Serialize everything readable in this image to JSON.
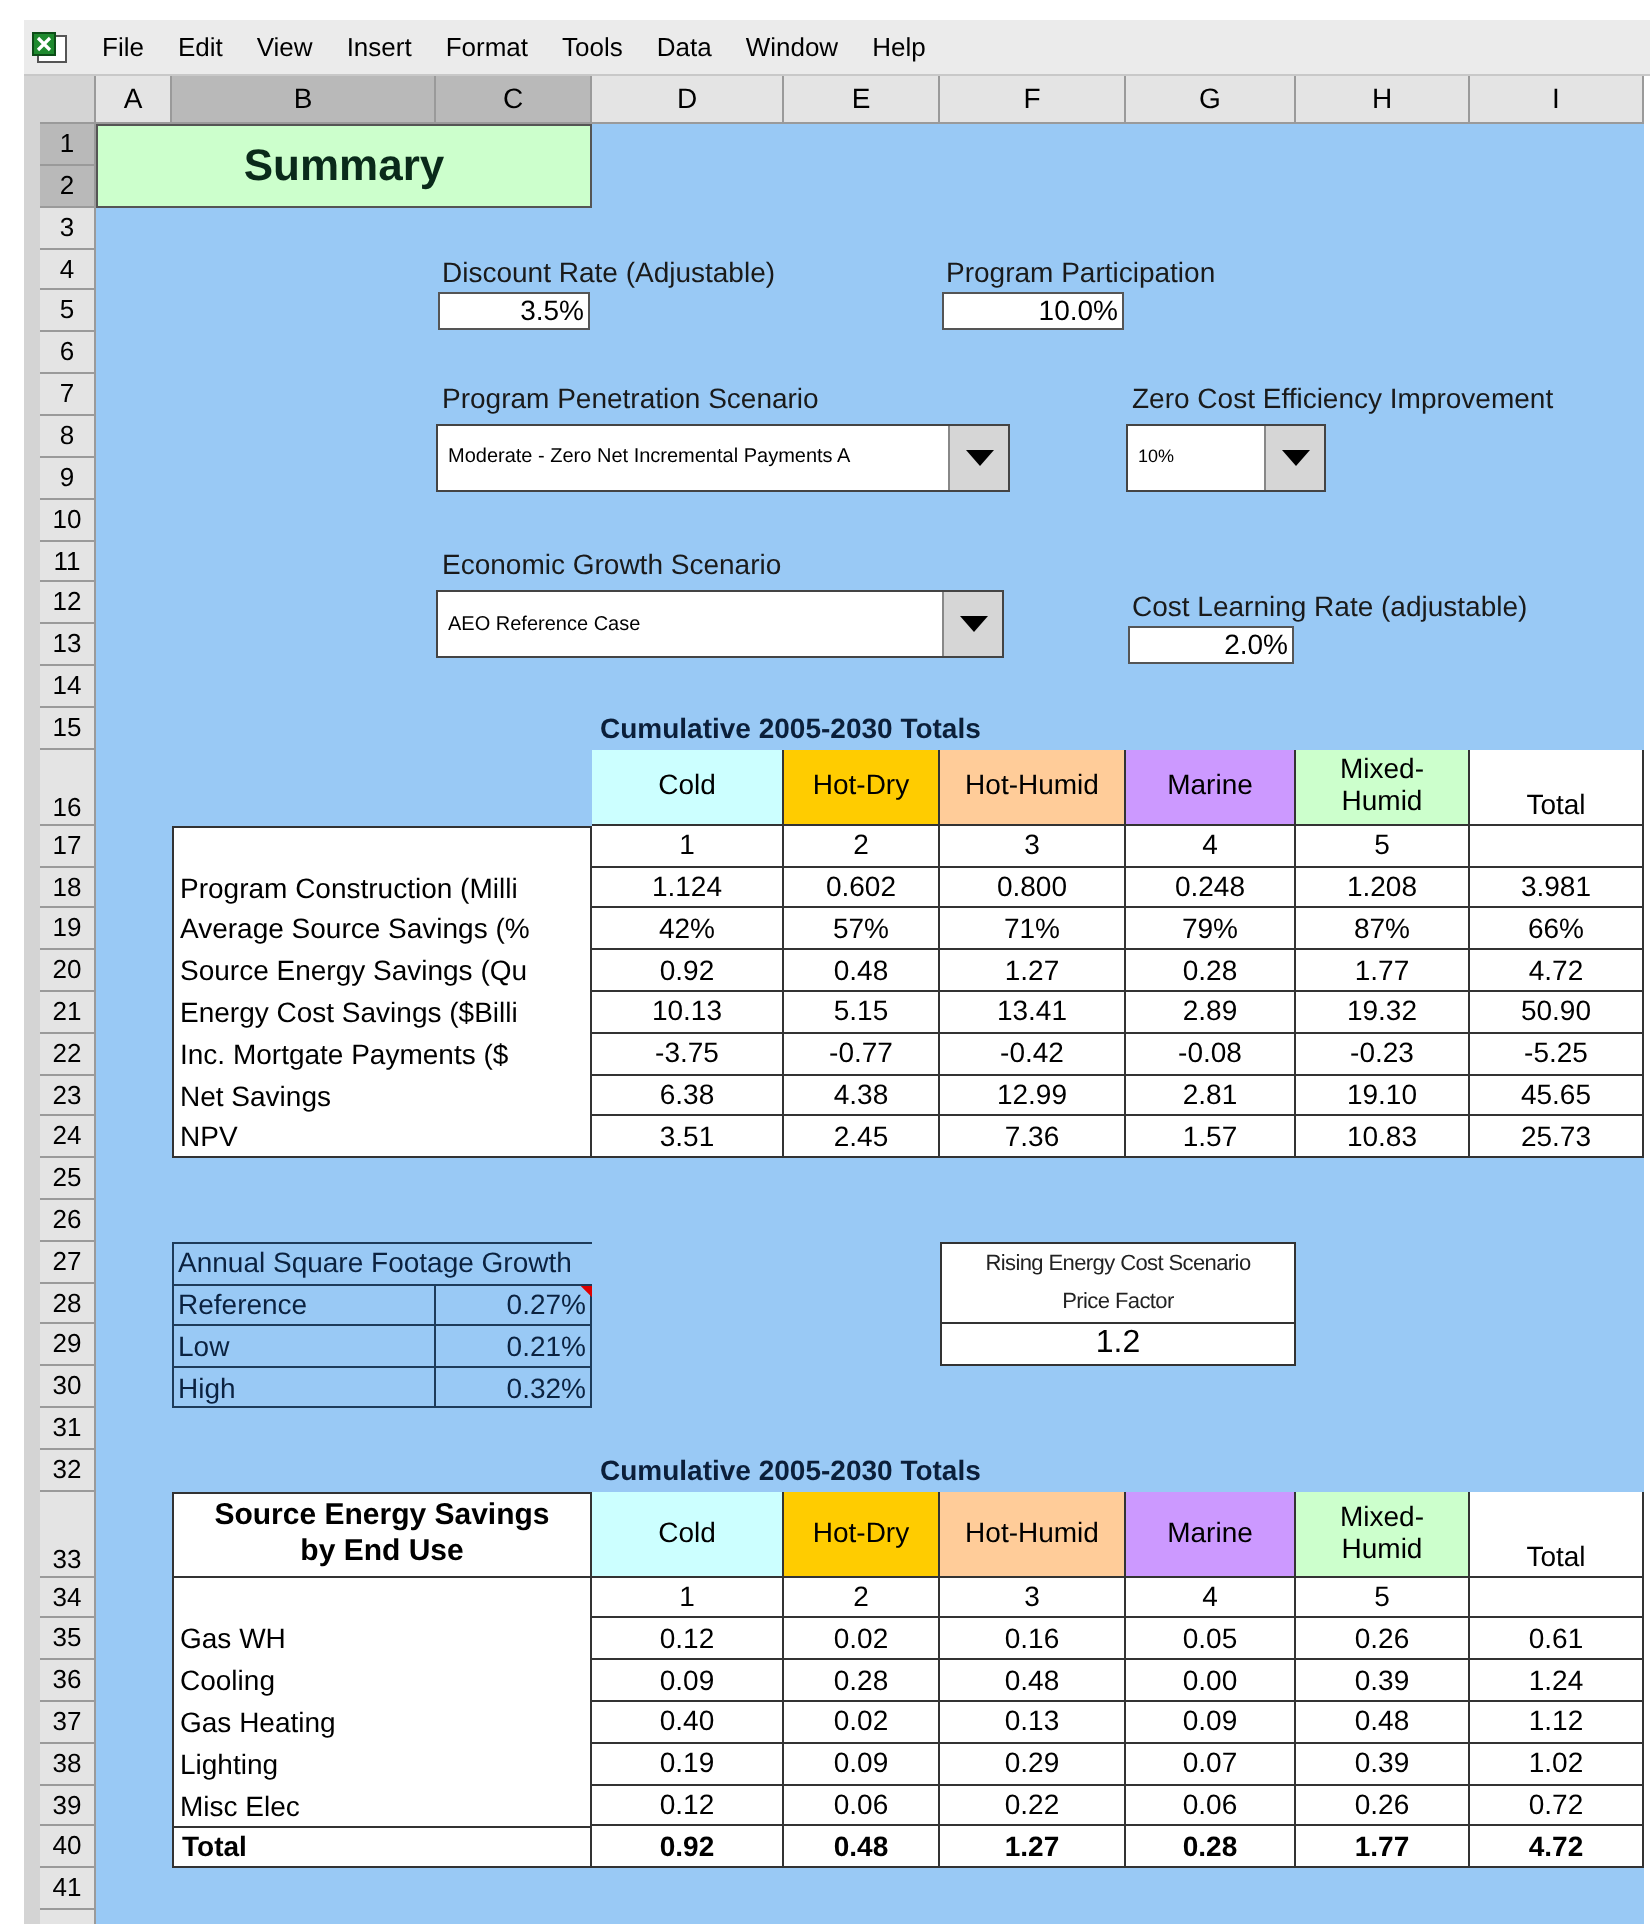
{
  "menu_bar": {
    "items": [
      "File",
      "Edit",
      "View",
      "Insert",
      "Format",
      "Tools",
      "Data",
      "Window",
      "Help"
    ]
  },
  "column_headers": [
    {
      "label": "A",
      "selected": false
    },
    {
      "label": "B",
      "selected": true
    },
    {
      "label": "C",
      "selected": true
    },
    {
      "label": "D",
      "selected": false
    },
    {
      "label": "E",
      "selected": false
    },
    {
      "label": "F",
      "selected": false
    },
    {
      "label": "G",
      "selected": false
    },
    {
      "label": "H",
      "selected": false
    },
    {
      "label": "I",
      "selected": false
    }
  ],
  "row_headers": [
    {
      "label": "1",
      "selected": true
    },
    {
      "label": "2",
      "selected": true
    },
    {
      "label": "3",
      "selected": false
    },
    {
      "label": "4",
      "selected": false
    },
    {
      "label": "5",
      "selected": false
    },
    {
      "label": "6",
      "selected": false
    },
    {
      "label": "7",
      "selected": false
    },
    {
      "label": "8",
      "selected": false
    },
    {
      "label": "9",
      "selected": false
    },
    {
      "label": "10",
      "selected": false
    },
    {
      "label": "11",
      "selected": false
    },
    {
      "label": "12",
      "selected": false
    },
    {
      "label": "13",
      "selected": false
    },
    {
      "label": "14",
      "selected": false
    },
    {
      "label": "15",
      "selected": false
    },
    {
      "label": "16",
      "selected": false
    },
    {
      "label": "17",
      "selected": false
    },
    {
      "label": "18",
      "selected": false
    },
    {
      "label": "19",
      "selected": false
    },
    {
      "label": "20",
      "selected": false
    },
    {
      "label": "21",
      "selected": false
    },
    {
      "label": "22",
      "selected": false
    },
    {
      "label": "23",
      "selected": false
    },
    {
      "label": "24",
      "selected": false
    },
    {
      "label": "25",
      "selected": false
    },
    {
      "label": "26",
      "selected": false
    },
    {
      "label": "27",
      "selected": false
    },
    {
      "label": "28",
      "selected": false
    },
    {
      "label": "29",
      "selected": false
    },
    {
      "label": "30",
      "selected": false
    },
    {
      "label": "31",
      "selected": false
    },
    {
      "label": "32",
      "selected": false
    },
    {
      "label": "33",
      "selected": false
    },
    {
      "label": "34",
      "selected": false
    },
    {
      "label": "35",
      "selected": false
    },
    {
      "label": "36",
      "selected": false
    },
    {
      "label": "37",
      "selected": false
    },
    {
      "label": "38",
      "selected": false
    },
    {
      "label": "39",
      "selected": false
    },
    {
      "label": "40",
      "selected": false
    },
    {
      "label": "41",
      "selected": false
    }
  ],
  "summary": {
    "title": "Summary"
  },
  "inputs": [
    {
      "label": "Discount Rate (Adjustable)",
      "value": "3.5%"
    },
    {
      "label": "Program Participation",
      "value": "10.0%"
    },
    {
      "label": "Cost Learning Rate (adjustable)",
      "value": "2.0%"
    }
  ],
  "dropdowns": [
    {
      "label": "Program Penetration Scenario",
      "value": "Moderate - Zero Net Incremental Payments A"
    },
    {
      "label": "Zero Cost Efficiency Improvement",
      "value": "10%"
    },
    {
      "label": "Economic Growth Scenario",
      "value": "AEO Reference Case"
    }
  ],
  "results_table": {
    "title": "Cumulative 2005-2030 Totals",
    "columns": [
      {
        "label": "Cold",
        "color": "#ccffff"
      },
      {
        "label": "Hot-Dry",
        "color": "#ffcc00"
      },
      {
        "label": "Hot-Humid",
        "color": "#ffcc99"
      },
      {
        "label": "Marine",
        "color": "#cc99ff"
      },
      {
        "label": "Mixed-Humid",
        "color": "#ccffcc"
      },
      {
        "label": "Total",
        "color": "#ffffff"
      }
    ],
    "zone_numbers": [
      "1",
      "2",
      "3",
      "4",
      "5"
    ],
    "rows": [
      {
        "label": "Program Construction (Milli",
        "cells": [
          "1.124",
          "0.602",
          "0.800",
          "0.248",
          "1.208",
          "3.981"
        ]
      },
      {
        "label": "Average Source Savings (%",
        "cells": [
          "42%",
          "57%",
          "71%",
          "79%",
          "87%",
          "66%"
        ]
      },
      {
        "label": "Source Energy Savings (Qu",
        "cells": [
          "0.92",
          "0.48",
          "1.27",
          "0.28",
          "1.77",
          "4.72"
        ]
      },
      {
        "label": "Energy Cost Savings ($Billi",
        "cells": [
          "10.13",
          "5.15",
          "13.41",
          "2.89",
          "19.32",
          "50.90"
        ]
      },
      {
        "label": "Inc. Mortgate Payments ($",
        "cells": [
          "-3.75",
          "-0.77",
          "-0.42",
          "-0.08",
          "-0.23",
          "-5.25"
        ]
      },
      {
        "label": "Net Savings",
        "cells": [
          "6.38",
          "4.38",
          "12.99",
          "2.81",
          "19.10",
          "45.65"
        ]
      },
      {
        "label": "NPV",
        "cells": [
          "3.51",
          "2.45",
          "7.36",
          "1.57",
          "10.83",
          "25.73"
        ]
      }
    ]
  },
  "square_footage_growth": {
    "title": "Annual Square Footage Growth",
    "rows": [
      {
        "label": "Reference",
        "value": "0.27%",
        "has_comment": true
      },
      {
        "label": "Low",
        "value": "0.21%",
        "has_comment": false
      },
      {
        "label": "High",
        "value": "0.32%",
        "has_comment": false
      }
    ]
  },
  "price_factor": {
    "title_lines": [
      "Rising Energy Cost Scenario",
      "Price Factor"
    ],
    "value": "1.2"
  },
  "end_use_table": {
    "title": "Cumulative 2005-2030 Totals",
    "header": "Source Energy Savings by End Use",
    "columns": [
      {
        "label": "Cold",
        "color": "#ccffff"
      },
      {
        "label": "Hot-Dry",
        "color": "#ffcc00"
      },
      {
        "label": "Hot-Humid",
        "color": "#ffcc99"
      },
      {
        "label": "Marine",
        "color": "#cc99ff"
      },
      {
        "label": "Mixed-Humid",
        "color": "#ccffcc"
      },
      {
        "label": "Total",
        "color": "#ffffff"
      }
    ],
    "zone_numbers": [
      "1",
      "2",
      "3",
      "4",
      "5"
    ],
    "rows": [
      {
        "label": "Gas WH",
        "cells": [
          "0.12",
          "0.02",
          "0.16",
          "0.05",
          "0.26",
          "0.61"
        ]
      },
      {
        "label": "Cooling",
        "cells": [
          "0.09",
          "0.28",
          "0.48",
          "0.00",
          "0.39",
          "1.24"
        ]
      },
      {
        "label": "Gas Heating",
        "cells": [
          "0.40",
          "0.02",
          "0.13",
          "0.09",
          "0.48",
          "1.12"
        ]
      },
      {
        "label": "Lighting",
        "cells": [
          "0.19",
          "0.09",
          "0.29",
          "0.07",
          "0.39",
          "1.02"
        ]
      },
      {
        "label": "Misc Elec",
        "cells": [
          "0.12",
          "0.06",
          "0.22",
          "0.06",
          "0.26",
          "0.72"
        ]
      }
    ],
    "total": {
      "label": "Total",
      "cells": [
        "0.92",
        "0.48",
        "1.27",
        "0.28",
        "1.77",
        "4.72"
      ]
    }
  }
}
